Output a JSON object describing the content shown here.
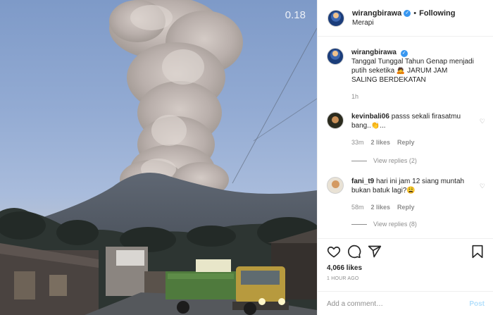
{
  "video": {
    "timer": "0.18"
  },
  "header": {
    "username": "wirangbirawa",
    "verified_mark": "✓",
    "separator": "•",
    "follow_status": "Following",
    "location": "Merapi"
  },
  "caption": {
    "username": "wirangbirawa",
    "text": "Tanggal Tunggal Tahun Genap menjadi putih seketika 🙇 JARUM JAM SALING BERDEKATAN",
    "time": "1h"
  },
  "comments": [
    {
      "username": "kevinbali06",
      "text": "passs sekali firasatmu bang..👏...",
      "time": "33m",
      "likes": "2 likes",
      "reply": "Reply",
      "view_replies": "View replies (2)"
    },
    {
      "username": "fani_t9",
      "text": "hari ini jam 12 siang muntah bukan batuk lagi?😩",
      "time": "58m",
      "likes": "2 likes",
      "reply": "Reply",
      "view_replies": "View replies (8)"
    }
  ],
  "actions": {
    "likes": "4,066 likes",
    "posted_ago": "1 HOUR AGO",
    "comment_placeholder": "Add a comment…",
    "post_label": "Post"
  },
  "icons": [
    "heart-icon",
    "comment-icon",
    "share-icon",
    "bookmark-icon"
  ],
  "colors": {
    "verified": "#3897f0",
    "muted_text": "#8e8e8e",
    "post_button_disabled": "#b2dffc"
  }
}
